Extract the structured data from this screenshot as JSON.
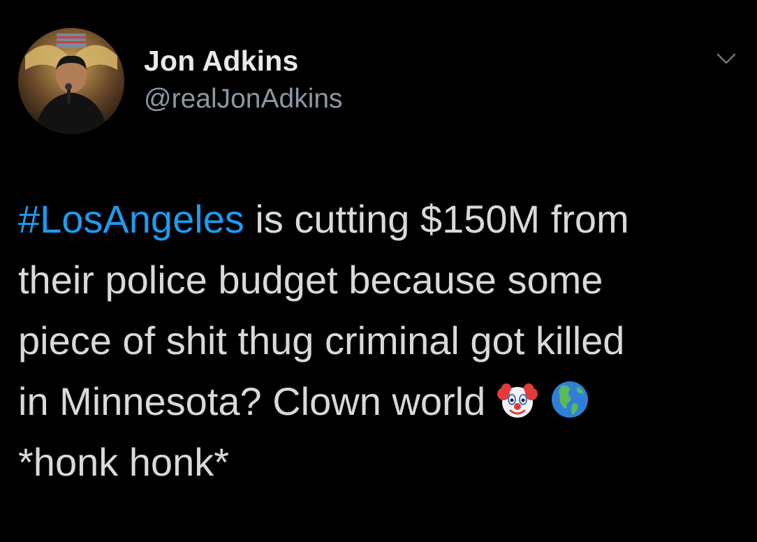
{
  "tweet": {
    "author": {
      "display_name": "Jon Adkins",
      "handle": "@realJonAdkins"
    },
    "text": {
      "hashtag": "#LosAngeles",
      "line1_rest": " is cutting $150M from",
      "line2": "their police budget because some",
      "line3": "piece of shit thug criminal got killed",
      "line4": "in Minnesota? Clown world",
      "line5": "*honk honk*"
    },
    "emojis": [
      "clown-face-emoji",
      "globe-americas-emoji"
    ],
    "icons": {
      "menu": "chevron-down-icon"
    },
    "colors": {
      "background": "#000000",
      "text": "#d9d9d9",
      "hashtag": "#1d9bf0",
      "handle": "#8b98a5"
    }
  }
}
